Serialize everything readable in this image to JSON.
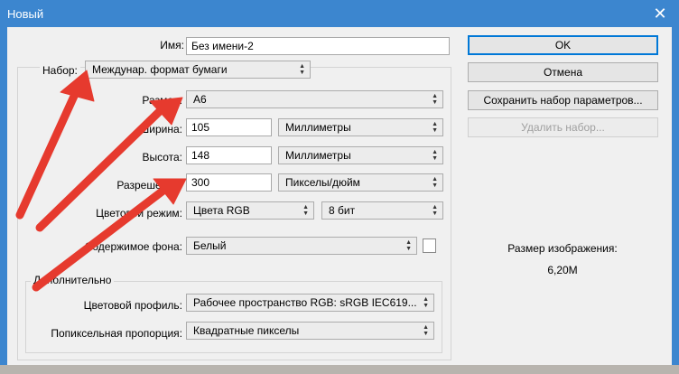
{
  "window": {
    "title": "Новый",
    "close_symbol": "✕"
  },
  "form": {
    "name_label": "Имя:",
    "name_value": "Без имени-2",
    "preset_label": "Набор:",
    "preset_value": "Междунар. формат бумаги",
    "size_label": "Размер:",
    "size_value": "A6",
    "width_label": "Ширина:",
    "width_value": "105",
    "width_unit": "Миллиметры",
    "height_label": "Высота:",
    "height_value": "148",
    "height_unit": "Миллиметры",
    "resolution_label": "Разрешение:",
    "resolution_value": "300",
    "resolution_unit": "Пикселы/дюйм",
    "color_mode_label": "Цветовой режим:",
    "color_mode_value": "Цвета RGB",
    "bit_depth_value": "8 бит",
    "background_label": "Содержимое фона:",
    "background_value": "Белый"
  },
  "advanced": {
    "title": "Дополнительно",
    "color_profile_label": "Цветовой профиль:",
    "color_profile_value": "Рабочее пространство RGB:  sRGB IEC619...",
    "pixel_aspect_label": "Попиксельная пропорция:",
    "pixel_aspect_value": "Квадратные пикселы"
  },
  "buttons": {
    "ok": "OK",
    "cancel": "Отмена",
    "save_preset": "Сохранить набор параметров...",
    "delete_preset": "Удалить набор..."
  },
  "image_info": {
    "size_label": "Размер изображения:",
    "size_value": "6,20M"
  },
  "colors": {
    "titlebar": "#3c86cf",
    "dialog_bg": "#f0f0f0",
    "annotation_arrow": "#e63a2e",
    "default_button_border": "#0078d7"
  },
  "icons": {
    "dropdown": "updown-arrow-icon",
    "close": "close-icon",
    "annotation": "red-arrow-annotation"
  }
}
